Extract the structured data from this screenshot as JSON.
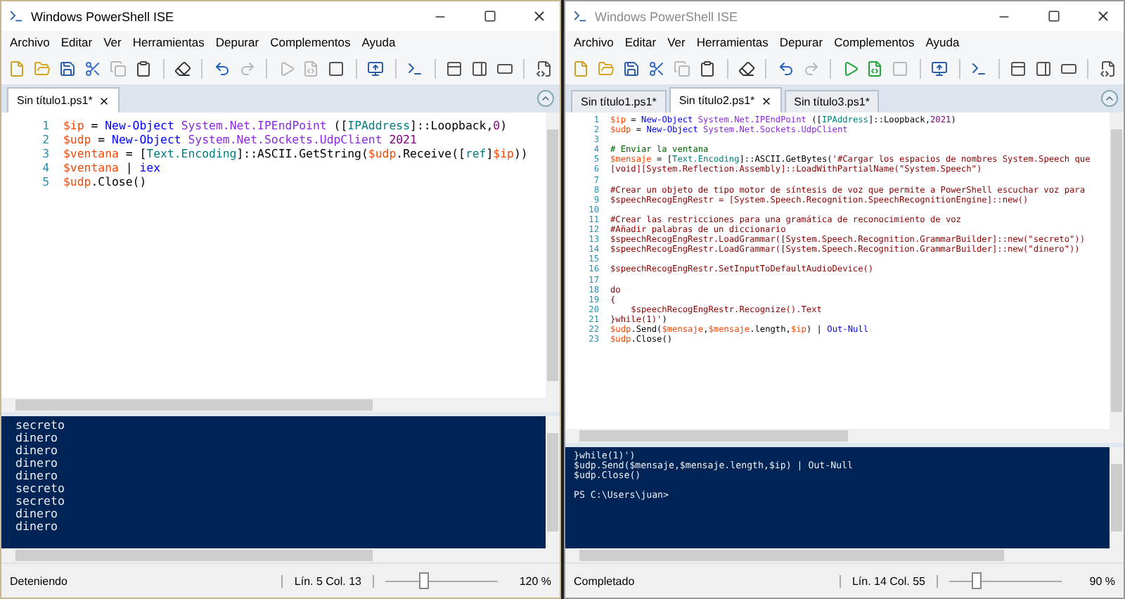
{
  "windows": [
    {
      "title": "Windows PowerShell ISE",
      "active": true,
      "menu": [
        "Archivo",
        "Editar",
        "Ver",
        "Herramientas",
        "Depurar",
        "Complementos",
        "Ayuda"
      ],
      "toolbar": [
        {
          "kind": "new",
          "disabled": false
        },
        {
          "kind": "open",
          "disabled": false
        },
        {
          "kind": "save",
          "disabled": false
        },
        {
          "kind": "cut",
          "disabled": false
        },
        {
          "kind": "copy",
          "disabled": true
        },
        {
          "kind": "paste",
          "disabled": false
        },
        {
          "kind": "clear",
          "disabled": false
        },
        {
          "kind": "undo",
          "disabled": false
        },
        {
          "kind": "redo",
          "disabled": true
        },
        {
          "kind": "run",
          "disabled": true
        },
        {
          "kind": "run-selection",
          "disabled": true
        },
        {
          "kind": "stop",
          "disabled": false
        },
        {
          "kind": "remote",
          "disabled": false
        },
        {
          "kind": "console",
          "disabled": false
        },
        {
          "kind": "layout-top",
          "disabled": false
        },
        {
          "kind": "layout-right",
          "disabled": false
        },
        {
          "kind": "layout-max",
          "disabled": false
        },
        {
          "kind": "snippets",
          "disabled": false
        }
      ],
      "tabs": [
        {
          "label": "Sin título1.ps1*",
          "selected": true
        }
      ],
      "code": [
        {
          "number": "1",
          "tokens": [
            {
              "kind": "variable",
              "text": "$ip"
            },
            {
              "kind": "plain",
              "text": " = "
            },
            {
              "kind": "command",
              "text": "New-Object"
            },
            {
              "kind": "argument",
              "text": " System.Net.IPEndPoint"
            },
            {
              "kind": "plain",
              "text": " (["
            },
            {
              "kind": "type",
              "text": "IPAddress"
            },
            {
              "kind": "plain",
              "text": "]::Loopback,"
            },
            {
              "kind": "number",
              "text": "0"
            },
            {
              "kind": "plain",
              "text": ")"
            }
          ]
        },
        {
          "number": "2",
          "tokens": [
            {
              "kind": "variable",
              "text": "$udp"
            },
            {
              "kind": "plain",
              "text": " = "
            },
            {
              "kind": "command",
              "text": "New-Object"
            },
            {
              "kind": "argument",
              "text": " System.Net.Sockets.UdpClient"
            },
            {
              "kind": "number",
              "text": " 2021"
            }
          ]
        },
        {
          "number": "3",
          "tokens": [
            {
              "kind": "variable",
              "text": "$ventana"
            },
            {
              "kind": "plain",
              "text": " = ["
            },
            {
              "kind": "type",
              "text": "Text.Encoding"
            },
            {
              "kind": "plain",
              "text": "]::ASCII.GetString("
            },
            {
              "kind": "variable",
              "text": "$udp"
            },
            {
              "kind": "plain",
              "text": ".Receive(["
            },
            {
              "kind": "type",
              "text": "ref"
            },
            {
              "kind": "plain",
              "text": "]"
            },
            {
              "kind": "variable",
              "text": "$ip"
            },
            {
              "kind": "plain",
              "text": "))"
            }
          ]
        },
        {
          "number": "4",
          "tokens": [
            {
              "kind": "variable",
              "text": "$ventana"
            },
            {
              "kind": "plain",
              "text": " | "
            },
            {
              "kind": "command",
              "text": "iex"
            }
          ]
        },
        {
          "number": "5",
          "tokens": [
            {
              "kind": "variable",
              "text": "$udp"
            },
            {
              "kind": "plain",
              "text": ".Close()"
            }
          ]
        }
      ],
      "console": [
        "secreto",
        "dinero",
        "dinero",
        "dinero",
        "dinero",
        "secreto",
        "secreto",
        "dinero",
        "dinero"
      ],
      "status": {
        "text": "Deteniendo",
        "position": "Lín. 5  Col. 13",
        "level": 0.3,
        "zoom": "120 %"
      }
    },
    {
      "title": "Windows PowerShell ISE",
      "active": false,
      "menu": [
        "Archivo",
        "Editar",
        "Ver",
        "Herramientas",
        "Depurar",
        "Complementos",
        "Ayuda"
      ],
      "toolbar": [
        {
          "kind": "new",
          "disabled": false
        },
        {
          "kind": "open",
          "disabled": false
        },
        {
          "kind": "save",
          "disabled": false
        },
        {
          "kind": "cut",
          "disabled": false
        },
        {
          "kind": "copy",
          "disabled": true
        },
        {
          "kind": "paste",
          "disabled": false
        },
        {
          "kind": "clear",
          "disabled": false
        },
        {
          "kind": "undo",
          "disabled": false
        },
        {
          "kind": "redo",
          "disabled": true
        },
        {
          "kind": "run",
          "disabled": false
        },
        {
          "kind": "run-selection",
          "disabled": false
        },
        {
          "kind": "stop",
          "disabled": true
        },
        {
          "kind": "remote",
          "disabled": false
        },
        {
          "kind": "console",
          "disabled": false
        },
        {
          "kind": "layout-top",
          "disabled": false
        },
        {
          "kind": "layout-right",
          "disabled": false
        },
        {
          "kind": "layout-max",
          "disabled": false
        },
        {
          "kind": "snippets",
          "disabled": false
        }
      ],
      "tabs": [
        {
          "label": "Sin título1.ps1*",
          "selected": false
        },
        {
          "label": "Sin título2.ps1*",
          "selected": true
        },
        {
          "label": "Sin título3.ps1*",
          "selected": false
        }
      ],
      "code": [
        {
          "number": "1",
          "tokens": [
            {
              "kind": "variable",
              "text": "$ip"
            },
            {
              "kind": "plain",
              "text": " = "
            },
            {
              "kind": "command",
              "text": "New-Object"
            },
            {
              "kind": "argument",
              "text": " System.Net.IPEndPoint"
            },
            {
              "kind": "plain",
              "text": " (["
            },
            {
              "kind": "type",
              "text": "IPAddress"
            },
            {
              "kind": "plain",
              "text": "]::Loopback,"
            },
            {
              "kind": "number",
              "text": "2021"
            },
            {
              "kind": "plain",
              "text": ")"
            }
          ]
        },
        {
          "number": "2",
          "tokens": [
            {
              "kind": "variable",
              "text": "$udp"
            },
            {
              "kind": "plain",
              "text": " = "
            },
            {
              "kind": "command",
              "text": "New-Object"
            },
            {
              "kind": "argument",
              "text": " System.Net.Sockets.UdpClient"
            }
          ]
        },
        {
          "number": "3"
        },
        {
          "number": "4",
          "tokens": [
            {
              "kind": "comment",
              "text": "# Enviar la ventana"
            }
          ]
        },
        {
          "number": "5",
          "tokens": [
            {
              "kind": "variable",
              "text": "$mensaje"
            },
            {
              "kind": "plain",
              "text": " = ["
            },
            {
              "kind": "type",
              "text": "Text.Encoding"
            },
            {
              "kind": "plain",
              "text": "]::ASCII.GetBytes("
            },
            {
              "kind": "string",
              "text": "'#Cargar los espacios de nombres System.Speech que"
            }
          ]
        },
        {
          "number": "6",
          "tokens": [
            {
              "kind": "string",
              "text": "[void][System.Reflection.Assembly]::LoadWithPartialName(\"System.Speech\")"
            }
          ]
        },
        {
          "number": "7"
        },
        {
          "number": "8",
          "tokens": [
            {
              "kind": "string",
              "text": "#Crear un objeto de tipo motor de síntesis de voz que permite a PowerShell escuchar voz para"
            }
          ]
        },
        {
          "number": "9",
          "tokens": [
            {
              "kind": "string",
              "text": "$speechRecogEngRestr = [System.Speech.Recognition.SpeechRecognitionEngine]::new()"
            }
          ]
        },
        {
          "number": "10"
        },
        {
          "number": "11",
          "tokens": [
            {
              "kind": "string",
              "text": "#Crear las restricciones para una gramática de reconocimiento de voz"
            }
          ]
        },
        {
          "number": "12",
          "tokens": [
            {
              "kind": "string",
              "text": "#Añadir palabras de un diccionario"
            }
          ]
        },
        {
          "number": "13",
          "tokens": [
            {
              "kind": "string",
              "text": "$speechRecogEngRestr.LoadGrammar([System.Speech.Recognition.GrammarBuilder]::new(\"secreto\"))"
            }
          ]
        },
        {
          "number": "14",
          "tokens": [
            {
              "kind": "string",
              "text": "$speechRecogEngRestr.LoadGrammar([System.Speech.Recognition.GrammarBuilder]::new(\"dinero\"))"
            }
          ]
        },
        {
          "number": "15"
        },
        {
          "number": "16",
          "tokens": [
            {
              "kind": "string",
              "text": "$speechRecogEngRestr.SetInputToDefaultAudioDevice()"
            }
          ]
        },
        {
          "number": "17"
        },
        {
          "number": "18",
          "tokens": [
            {
              "kind": "string",
              "text": "do"
            }
          ]
        },
        {
          "number": "19",
          "tokens": [
            {
              "kind": "string",
              "text": "{"
            }
          ]
        },
        {
          "number": "20",
          "tokens": [
            {
              "kind": "string",
              "text": "    $speechRecogEngRestr.Recognize().Text"
            }
          ]
        },
        {
          "number": "21",
          "tokens": [
            {
              "kind": "string",
              "text": "}while(1)'"
            },
            {
              "kind": "plain",
              "text": ")"
            }
          ]
        },
        {
          "number": "22",
          "tokens": [
            {
              "kind": "variable",
              "text": "$udp"
            },
            {
              "kind": "plain",
              "text": ".Send("
            },
            {
              "kind": "variable",
              "text": "$mensaje"
            },
            {
              "kind": "plain",
              "text": ","
            },
            {
              "kind": "variable",
              "text": "$mensaje"
            },
            {
              "kind": "plain",
              "text": ".length,"
            },
            {
              "kind": "variable",
              "text": "$ip"
            },
            {
              "kind": "plain",
              "text": ") | "
            },
            {
              "kind": "command",
              "text": "Out-Null"
            }
          ]
        },
        {
          "number": "23",
          "tokens": [
            {
              "kind": "variable",
              "text": "$udp"
            },
            {
              "kind": "plain",
              "text": ".Close()"
            }
          ]
        }
      ],
      "console": [
        "}while(1)')",
        "$udp.Send($mensaje,$mensaje.length,$ip) | Out-Null",
        "$udp.Close()"
      ],
      "prompt": "PS C:\\Users\\juan>",
      "status": {
        "text": "Completado",
        "position": "Lín. 14  Col. 55",
        "level": 0.2,
        "zoom": "90 %"
      }
    }
  ]
}
